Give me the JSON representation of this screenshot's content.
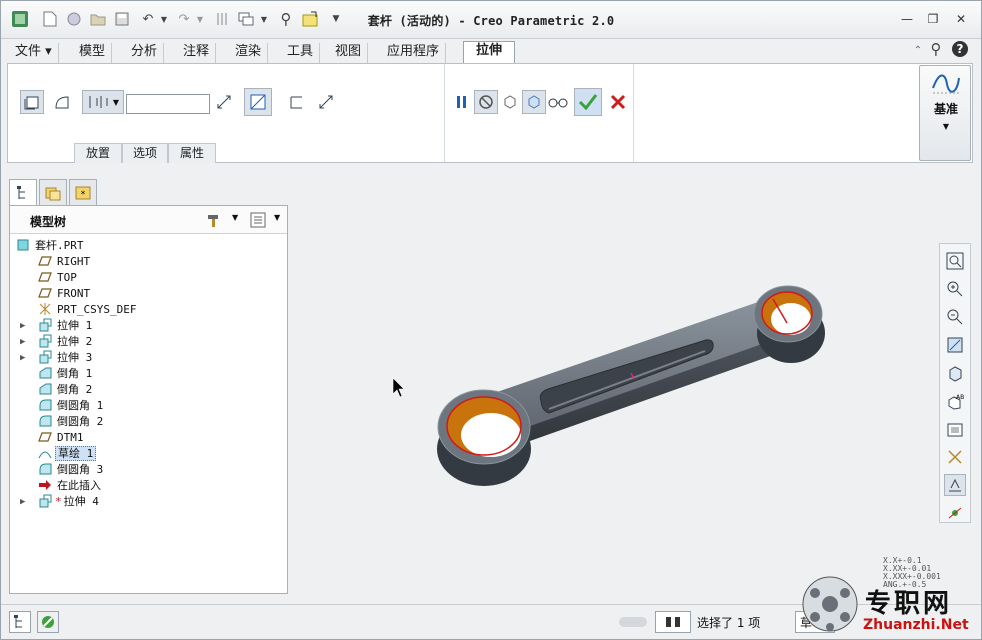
{
  "window": {
    "title": "套杆 (活动的) - Creo Parametric 2.0"
  },
  "menu": {
    "tabs": [
      "文件",
      "模型",
      "分析",
      "注释",
      "渲染",
      "工具",
      "视图",
      "应用程序",
      "拉伸"
    ],
    "active": "拉伸"
  },
  "ribbon": {
    "subtabs": [
      "放置",
      "选项",
      "属性"
    ],
    "datum_label": "基准"
  },
  "tree": {
    "title": "模型树",
    "items": [
      {
        "label": "套杆.PRT",
        "icon": "part-icon",
        "expand": false,
        "indent": 0
      },
      {
        "label": "RIGHT",
        "icon": "datum-plane-icon",
        "expand": false,
        "indent": 1
      },
      {
        "label": "TOP",
        "icon": "datum-plane-icon",
        "expand": false,
        "indent": 1
      },
      {
        "label": "FRONT",
        "icon": "datum-plane-icon",
        "expand": false,
        "indent": 1
      },
      {
        "label": "PRT_CSYS_DEF",
        "icon": "csys-icon",
        "expand": false,
        "indent": 1
      },
      {
        "label": "拉伸 1",
        "icon": "extrude-icon",
        "expand": true,
        "indent": 1
      },
      {
        "label": "拉伸 2",
        "icon": "extrude-icon",
        "expand": true,
        "indent": 1
      },
      {
        "label": "拉伸 3",
        "icon": "extrude-icon",
        "expand": true,
        "indent": 1
      },
      {
        "label": "倒角 1",
        "icon": "chamfer-icon",
        "expand": false,
        "indent": 1
      },
      {
        "label": "倒角 2",
        "icon": "chamfer-icon",
        "expand": false,
        "indent": 1
      },
      {
        "label": "倒圆角 1",
        "icon": "round-icon",
        "expand": false,
        "indent": 1
      },
      {
        "label": "倒圆角 2",
        "icon": "round-icon",
        "expand": false,
        "indent": 1
      },
      {
        "label": "DTM1",
        "icon": "datum-plane-icon",
        "expand": false,
        "indent": 1
      },
      {
        "label": "草绘 1",
        "icon": "sketch-icon",
        "expand": false,
        "indent": 1,
        "selected": true
      },
      {
        "label": "倒圆角 3",
        "icon": "round-icon",
        "expand": false,
        "indent": 1
      },
      {
        "label": "在此插入",
        "icon": "insert-arrow-icon",
        "expand": false,
        "indent": 1
      },
      {
        "label": "拉伸 4",
        "icon": "extrude-new-icon",
        "expand": true,
        "indent": 1
      }
    ]
  },
  "status": {
    "text": "选择了 1 项",
    "partial": "草"
  },
  "watermark": {
    "name": "专职网",
    "url": "Zhuanzhi.Net",
    "tolerances": [
      "X.X+-0.1",
      "X.XX+-0.01",
      "X.XXX+-0.001",
      "ANG.+-0.5"
    ]
  },
  "colors": {
    "accent": "#1f62b5",
    "ok": "#3aa23a",
    "cancel": "#d11a1a",
    "model": "#6b7480",
    "face": "#c8730c"
  }
}
